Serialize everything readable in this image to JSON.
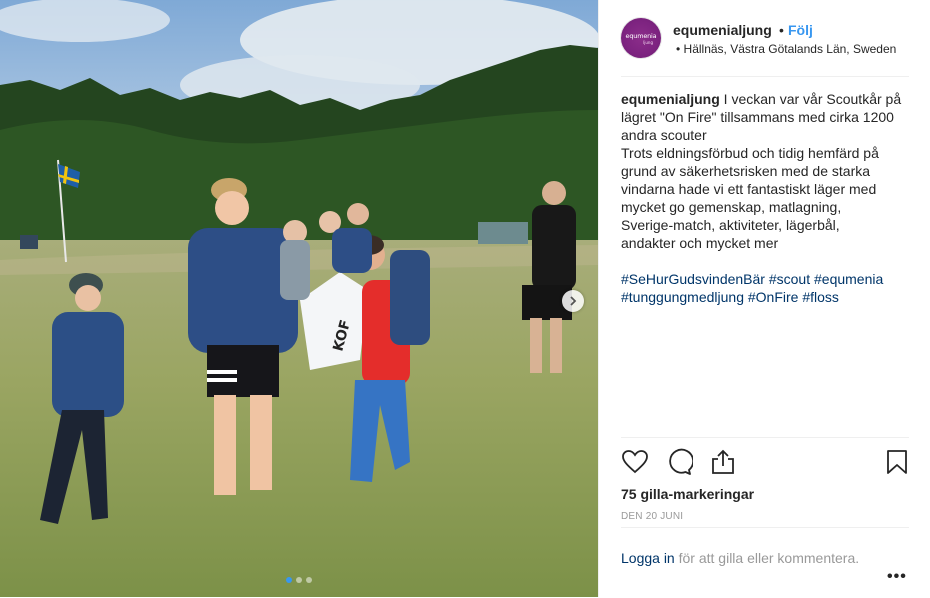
{
  "header": {
    "avatar_text": "equmenia",
    "avatar_subtext": "ljung",
    "username": "equmenialjung",
    "separator": "•",
    "follow_label": "Följ",
    "location": "• Hällnäs, Västra Götalands Län, Sweden"
  },
  "caption": {
    "username": "equmenialjung",
    "lines": [
      " I veckan var vår Scoutkår på",
      "lägret \"On Fire\" tillsammans med cirka 1200",
      "andra scouter",
      "Trots eldningsförbud och tidig hemfärd på",
      "grund av säkerhetsrisken med de starka",
      "vindarna hade vi ett fantastiskt läger med",
      "mycket go gemenskap, matlagning,",
      "Sverige-match, aktiviteter, lägerbål,",
      "andakter och mycket mer"
    ],
    "tags_line1": "#SeHurGudsvindenBär #scout #equmenia",
    "tags_line2": "#tunggungmedljung #OnFire #floss"
  },
  "photo": {
    "sign_text": "KOF",
    "carousel_count": 3,
    "carousel_active": 1
  },
  "actions": {
    "icons": [
      "heart-icon",
      "comment-icon",
      "share-icon",
      "bookmark-icon"
    ],
    "likes": "75 gilla-markeringar",
    "date": "DEN 20 JUNI"
  },
  "footer": {
    "login_link": "Logga in",
    "login_rest": " för att gilla eller kommentera.",
    "more": "•••"
  },
  "colors": {
    "link_blue": "#3897f0",
    "hashtag": "#003569",
    "avatar_purple": "#7d2380"
  }
}
